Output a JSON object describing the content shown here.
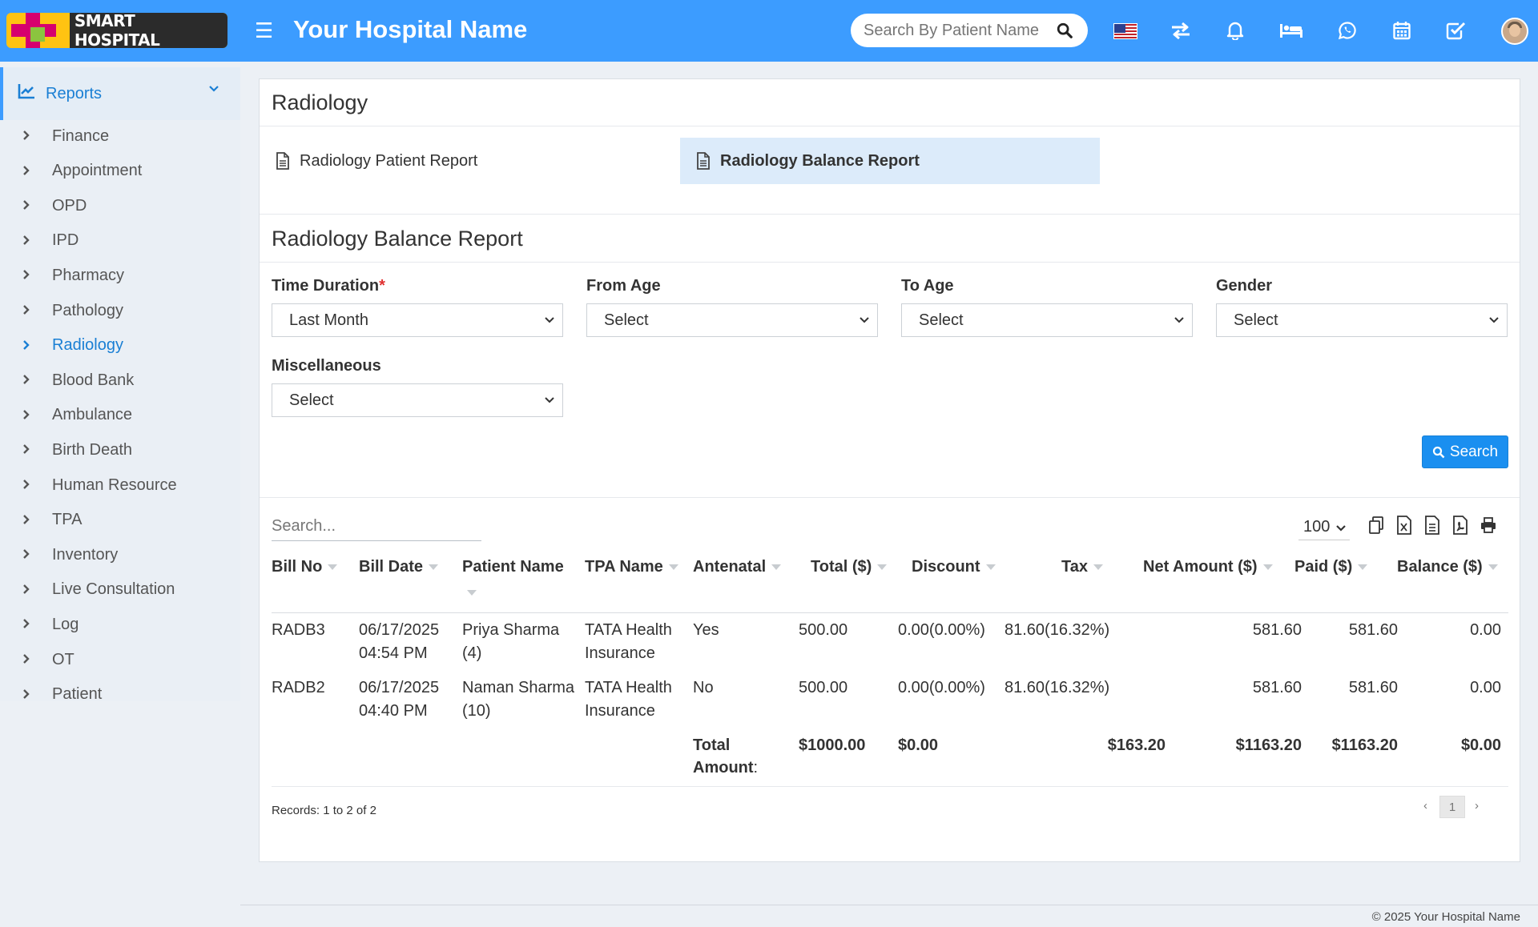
{
  "header": {
    "logo_text": "SMART HOSPITAL",
    "hospital_name": "Your Hospital Name",
    "search_placeholder": "Search By Patient Name"
  },
  "sidebar": {
    "section": "Reports",
    "items": [
      {
        "label": "Finance"
      },
      {
        "label": "Appointment"
      },
      {
        "label": "OPD"
      },
      {
        "label": "IPD"
      },
      {
        "label": "Pharmacy"
      },
      {
        "label": "Pathology"
      },
      {
        "label": "Radiology",
        "active": true
      },
      {
        "label": "Blood Bank"
      },
      {
        "label": "Ambulance"
      },
      {
        "label": "Birth Death"
      },
      {
        "label": "Human Resource"
      },
      {
        "label": "TPA"
      },
      {
        "label": "Inventory"
      },
      {
        "label": "Live Consultation"
      },
      {
        "label": "Log"
      },
      {
        "label": "OT"
      },
      {
        "label": "Patient"
      }
    ]
  },
  "main": {
    "title": "Radiology",
    "report_links": [
      "Radiology Patient Report",
      "Radiology Balance Report"
    ],
    "sub_title": "Radiology Balance Report",
    "filters": {
      "time_duration": {
        "label": "Time Duration",
        "required": "*",
        "value": "Last Month"
      },
      "from_age": {
        "label": "From Age",
        "value": "Select"
      },
      "to_age": {
        "label": "To Age",
        "value": "Select"
      },
      "gender": {
        "label": "Gender",
        "value": "Select"
      },
      "miscellaneous": {
        "label": "Miscellaneous",
        "value": "Select"
      }
    },
    "search_button": "Search",
    "table": {
      "search_placeholder": "Search...",
      "page_length": "100",
      "columns": [
        "Bill No",
        "Bill Date",
        "Patient Name",
        "TPA Name",
        "Antenatal",
        "Total ($)",
        "Discount",
        "Tax",
        "Net Amount ($)",
        "Paid ($)",
        "Balance ($)"
      ],
      "rows": [
        {
          "bill_no": "RADB3",
          "bill_date": [
            "06/17/2025",
            "04:54 PM"
          ],
          "patient": [
            "Priya Sharma",
            "(4)"
          ],
          "tpa": [
            "TATA Health",
            "Insurance"
          ],
          "antenatal": "Yes",
          "total": "500.00",
          "discount": "0.00(0.00%)",
          "tax": "81.60(16.32%)",
          "net": "581.60",
          "paid": "581.60",
          "balance": "0.00"
        },
        {
          "bill_no": "RADB2",
          "bill_date": [
            "06/17/2025",
            "04:40 PM"
          ],
          "patient": [
            "Naman Sharma",
            "(10)"
          ],
          "tpa": [
            "TATA Health",
            "Insurance"
          ],
          "antenatal": "No",
          "total": "500.00",
          "discount": "0.00(0.00%)",
          "tax": "81.60(16.32%)",
          "net": "581.60",
          "paid": "581.60",
          "balance": "0.00"
        }
      ],
      "totals": {
        "label_line1": "Total",
        "label_line2": "Amount",
        "label_colon": ":",
        "total": "$1000.00",
        "discount": "$0.00",
        "tax": "$163.20",
        "net": "$1163.20",
        "paid": "$1163.20",
        "balance": "$0.00"
      },
      "records_text": "Records: 1 to 2 of 2",
      "current_page": "1"
    }
  },
  "footer": {
    "copyright": "© 2025 Your Hospital Name"
  },
  "colors": {
    "header": "#3c9cff",
    "accent": "#1a7fd4",
    "selected_link_bg": "#dcebfa",
    "search_button": "#1a8ff0"
  }
}
